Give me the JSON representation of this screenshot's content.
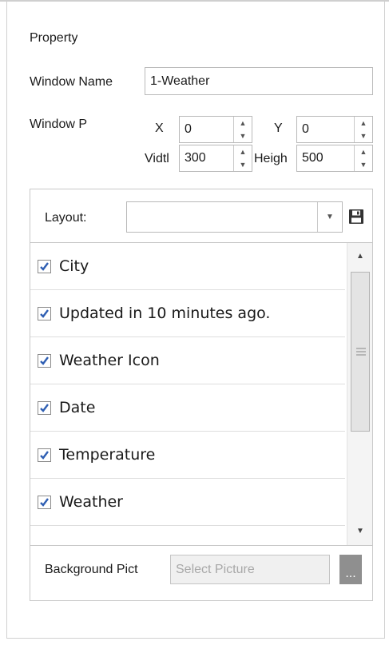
{
  "panel": {
    "title": "Property",
    "window_name_label": "Window Name",
    "window_name_value": "1-Weather",
    "window_pos_label": "Window P",
    "x_label": "X",
    "x_value": "0",
    "y_label": "Y",
    "y_value": "0",
    "width_label": "Vidtl",
    "width_value": "300",
    "height_label": "Heigh",
    "height_value": "500"
  },
  "layout": {
    "label": "Layout:",
    "value": ""
  },
  "items": [
    {
      "label": "City",
      "checked": true
    },
    {
      "label": "Updated in 10 minutes ago.",
      "checked": true
    },
    {
      "label": "Weather Icon",
      "checked": true
    },
    {
      "label": "Date",
      "checked": true
    },
    {
      "label": "Temperature",
      "checked": true
    },
    {
      "label": "Weather",
      "checked": true
    }
  ],
  "background": {
    "label": "Background Pict",
    "placeholder": "Select Picture",
    "browse_label": "..."
  },
  "colors": {
    "checkbox_check": "#2f5fb3",
    "browse_button": "#8f8f8f"
  }
}
